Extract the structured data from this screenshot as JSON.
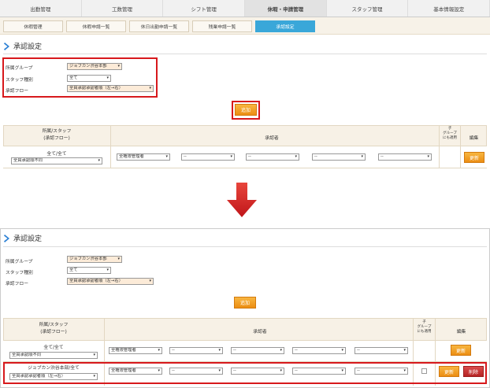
{
  "topnav": [
    "出勤管理",
    "工数管理",
    "シフト管理",
    "休暇・申請管理",
    "スタッフ管理",
    "基本情報設定"
  ],
  "subnav": [
    "休暇管理",
    "休暇申請一覧",
    "休日出勤申請一覧",
    "残業申請一覧",
    "承認設定"
  ],
  "title": "承認設定",
  "form": {
    "group_label": "所属グループ",
    "group_value": "ジョブカン渋谷本部",
    "stafftype_label": "スタッフ種別",
    "stafftype_value": "全て",
    "flow_label": "承認フロー",
    "flow_value": "全員承認承認者順（左→右）"
  },
  "add_label": "追加",
  "table": {
    "col1": "所属/スタッフ\n(承認フロー)",
    "col2": "承認者",
    "col3": "子\nグループ\nにも適用",
    "col4": "編集",
    "row1_name": "全て/全て",
    "row1_flow": "全員承認順不同",
    "row2_name": "ジョブカン渋谷本部/全て",
    "row2_flow": "全員承認承認者順（左→右）",
    "approver1": "全権限管理者",
    "approver_other": "--",
    "update_label": "更新",
    "delete_label": "削除"
  }
}
